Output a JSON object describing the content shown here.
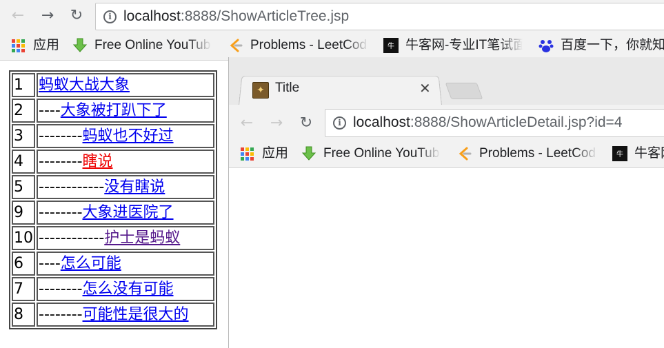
{
  "main_browser": {
    "url_host": "localhost",
    "url_rest": ":8888/ShowArticleTree.jsp",
    "bookmarks": [
      {
        "label": "应用",
        "icon": "apps-grid-icon"
      },
      {
        "label": "Free Online YouTub",
        "icon": "download-arrow-icon"
      },
      {
        "label": "Problems - LeetCod",
        "icon": "leetcode-icon"
      },
      {
        "label": "牛客网-专业IT笔试面",
        "icon": "nowcoder-icon"
      },
      {
        "label": "百度一下，你就知道",
        "icon": "baidu-paw-icon"
      }
    ]
  },
  "articles": [
    {
      "id": "1",
      "prefix": "",
      "title": "蚂蚁大战大象",
      "state": "link"
    },
    {
      "id": "2",
      "prefix": "----",
      "title": "大象被打趴下了",
      "state": "link"
    },
    {
      "id": "3",
      "prefix": "--------",
      "title": "蚂蚁也不好过",
      "state": "link"
    },
    {
      "id": "4",
      "prefix": "--------",
      "title": "瞎说",
      "state": "active"
    },
    {
      "id": "5",
      "prefix": "------------",
      "title": "没有瞎说",
      "state": "link"
    },
    {
      "id": "9",
      "prefix": "--------",
      "title": "大象进医院了",
      "state": "link"
    },
    {
      "id": "10",
      "prefix": "------------",
      "title": "护士是蚂蚁",
      "state": "visited"
    },
    {
      "id": "6",
      "prefix": "----",
      "title": "怎么可能",
      "state": "link"
    },
    {
      "id": "7",
      "prefix": "--------",
      "title": "怎么没有可能",
      "state": "link"
    },
    {
      "id": "8",
      "prefix": "--------",
      "title": "可能性是很大的",
      "state": "link"
    }
  ],
  "popup": {
    "tab_title": "Title",
    "url_host": "localhost",
    "url_rest": ":8888/ShowArticleDetail.jsp?id=4",
    "bookmarks": [
      {
        "label": "应用",
        "icon": "apps-grid-icon"
      },
      {
        "label": "Free Online YouTub",
        "icon": "download-arrow-icon"
      },
      {
        "label": "Problems - LeetCod",
        "icon": "leetcode-icon"
      },
      {
        "label": "牛客网",
        "icon": "nowcoder-icon"
      }
    ]
  },
  "colors": {
    "link": "#0000ee",
    "active_link": "#ee0000",
    "visited_link": "#551a8b"
  }
}
